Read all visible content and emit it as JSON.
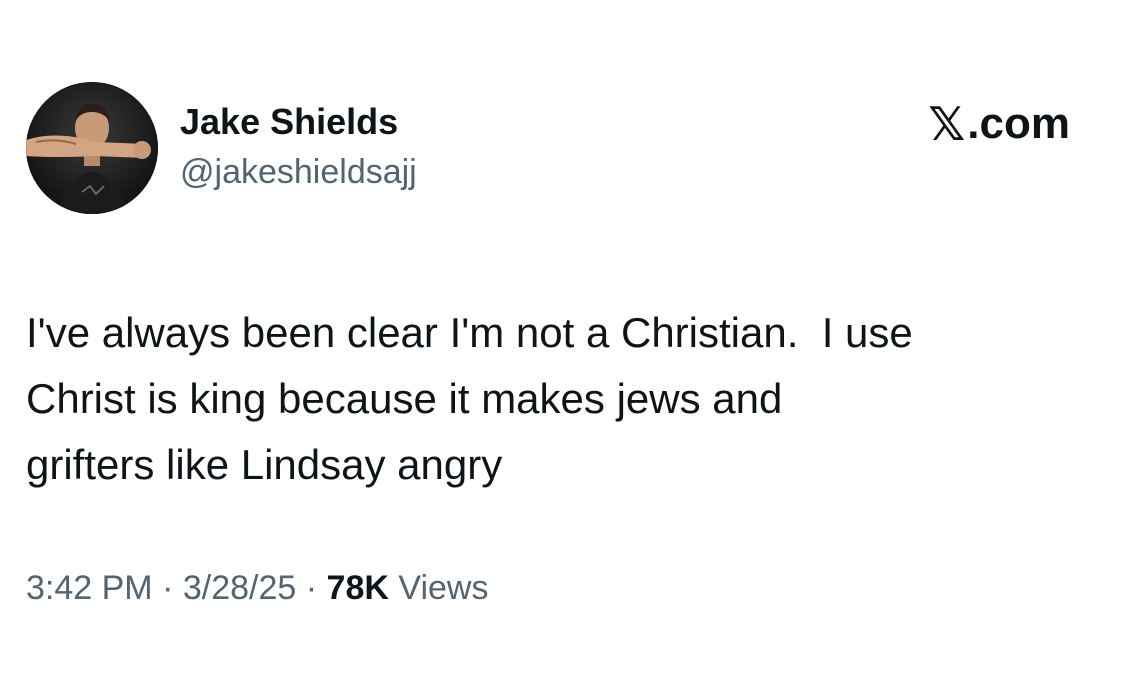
{
  "author": {
    "display_name": "Jake Shields",
    "handle": "@jakeshieldsajj"
  },
  "brand": {
    "x_glyph": "𝕏",
    "domain": ".com"
  },
  "tweet": {
    "lines": [
      "I've always been clear I'm not a Christian.  I use",
      "Christ is king because it makes jews and",
      "grifters like Lindsay angry"
    ]
  },
  "meta": {
    "time": "3:42 PM",
    "separator": "·",
    "date": "3/28/25",
    "views_count": "78K",
    "views_label": "Views"
  },
  "colors": {
    "text_primary": "#0f1419",
    "text_secondary": "#536471",
    "background": "#ffffff"
  },
  "icons": {
    "avatar": "profile-photo",
    "brand": "x-logo"
  }
}
